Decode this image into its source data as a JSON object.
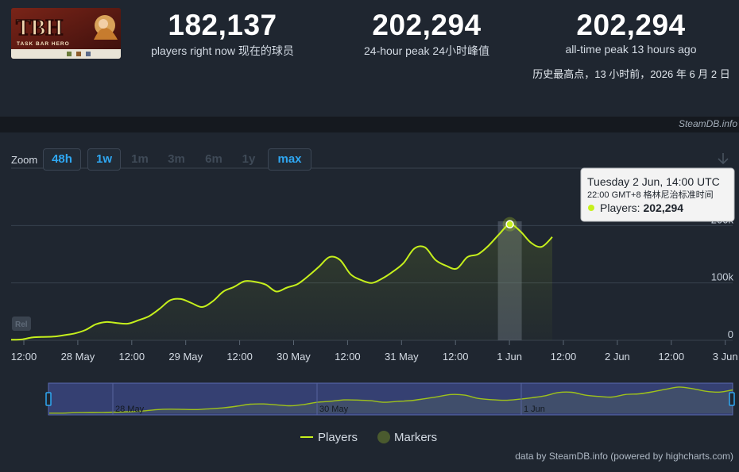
{
  "game": {
    "logo_text": "TBH",
    "logo_subtitle": "TASK BAR HERO"
  },
  "stats": {
    "current": {
      "value": "182,137",
      "label": "players right now  现在的球员"
    },
    "peak24": {
      "value": "202,294",
      "label": "24-hour peak  24小时峰值"
    },
    "alltime": {
      "value": "202,294",
      "label": "all-time peak 13 hours ago"
    },
    "alltime_note": "历史最高点，13 小时前，2026 年 6 月 2 日"
  },
  "brand": "SteamDB.info",
  "zoom": {
    "label": "Zoom",
    "buttons": [
      {
        "label": "48h",
        "active": true
      },
      {
        "label": "1w",
        "active": true
      },
      {
        "label": "1m",
        "active": false
      },
      {
        "label": "3m",
        "active": false
      },
      {
        "label": "6m",
        "active": false
      },
      {
        "label": "1y",
        "active": false
      },
      {
        "label": "max",
        "active": true
      }
    ]
  },
  "tooltip": {
    "title": "Tuesday 2 Jun, 14:00 UTC",
    "subtitle": "22:00 GMT+8  格林尼治标准时间",
    "series_label": "Players: ",
    "series_value": "202,294"
  },
  "rel_badge": "Rel",
  "legend": {
    "players": "Players",
    "markers": "Markers"
  },
  "credit": "data by SteamDB.info (powered by highcharts.com)",
  "colors": {
    "line": "#c6f01c",
    "marker": "#4a5a2e",
    "accent": "#2fa7f2"
  },
  "chart_data": {
    "type": "line",
    "series": [
      {
        "name": "Players",
        "x_hours": [
          0,
          3,
          6,
          9,
          12,
          15,
          18,
          21,
          24,
          27,
          30,
          33,
          36,
          39,
          42,
          45,
          48,
          51,
          54,
          57,
          60,
          63,
          66,
          69,
          72,
          75,
          78,
          81,
          84,
          87,
          90,
          93,
          96,
          99,
          102,
          105,
          108,
          111,
          114,
          117,
          120,
          123,
          126,
          129,
          132,
          135,
          138,
          141,
          144,
          147,
          150,
          153,
          156,
          159,
          162,
          165,
          168,
          171,
          174,
          177,
          180,
          183,
          186,
          189,
          192,
          195,
          198,
          201,
          204
        ],
        "values": [
          1000,
          1500,
          5000,
          6000,
          6500,
          9000,
          12000,
          18000,
          28000,
          32000,
          30000,
          29000,
          35000,
          42000,
          55000,
          70000,
          72000,
          65000,
          58000,
          68000,
          85000,
          93000,
          103000,
          102000,
          97000,
          85000,
          92000,
          98000,
          112000,
          128000,
          145000,
          140000,
          115000,
          105000,
          100000,
          108000,
          120000,
          135000,
          160000,
          162000,
          140000,
          130000,
          125000,
          145000,
          150000,
          165000,
          185000,
          202294,
          190000,
          170000,
          163000,
          180000
        ]
      }
    ],
    "x_tick_labels": [
      "12:00",
      "28 May",
      "12:00",
      "29 May",
      "12:00",
      "30 May",
      "12:00",
      "31 May",
      "12:00",
      "1 Jun",
      "12:00",
      "2 Jun",
      "12:00",
      "3 Jun"
    ],
    "y_tick_labels": [
      "0",
      "100k",
      "200k"
    ],
    "ylim": [
      0,
      300000
    ],
    "navigator_labels": [
      "28 May",
      "30 May",
      "1 Jun"
    ],
    "grid": true,
    "legend_position": "bottom-center"
  }
}
